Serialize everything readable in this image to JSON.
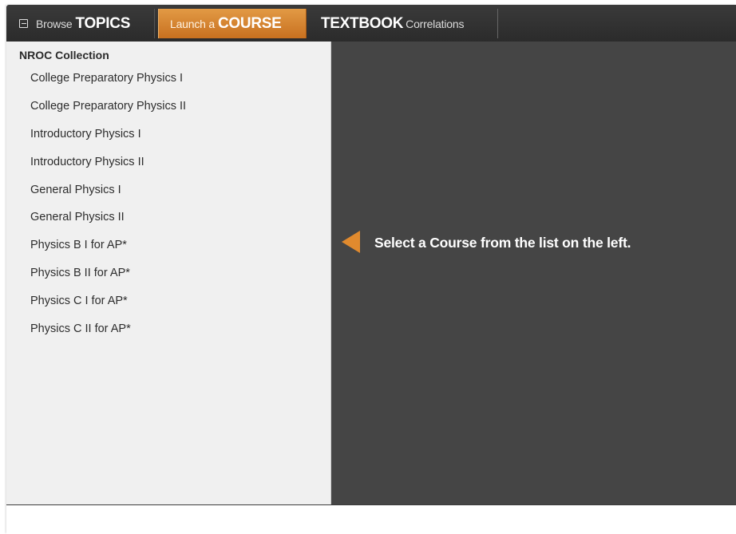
{
  "nav": {
    "topics": {
      "light": "Browse",
      "bold": "TOPICS"
    },
    "course": {
      "light": "Launch a",
      "bold": "COURSE"
    },
    "textbook": {
      "bold": "TEXTBOOK",
      "light": "Correlations"
    },
    "active_tab": "course",
    "accent_color": "#d9842f"
  },
  "sidebar": {
    "collection_title": "NROC Collection",
    "courses": [
      "College Preparatory Physics I",
      "College Preparatory Physics II",
      "Introductory Physics I",
      "Introductory Physics II",
      "General Physics I",
      "General Physics II",
      "Physics B I for AP*",
      "Physics B II for AP*",
      "Physics C I for AP*",
      "Physics C II for AP*"
    ]
  },
  "main": {
    "prompt": "Select a Course from the list on the left.",
    "icon": "left-arrow-icon"
  }
}
